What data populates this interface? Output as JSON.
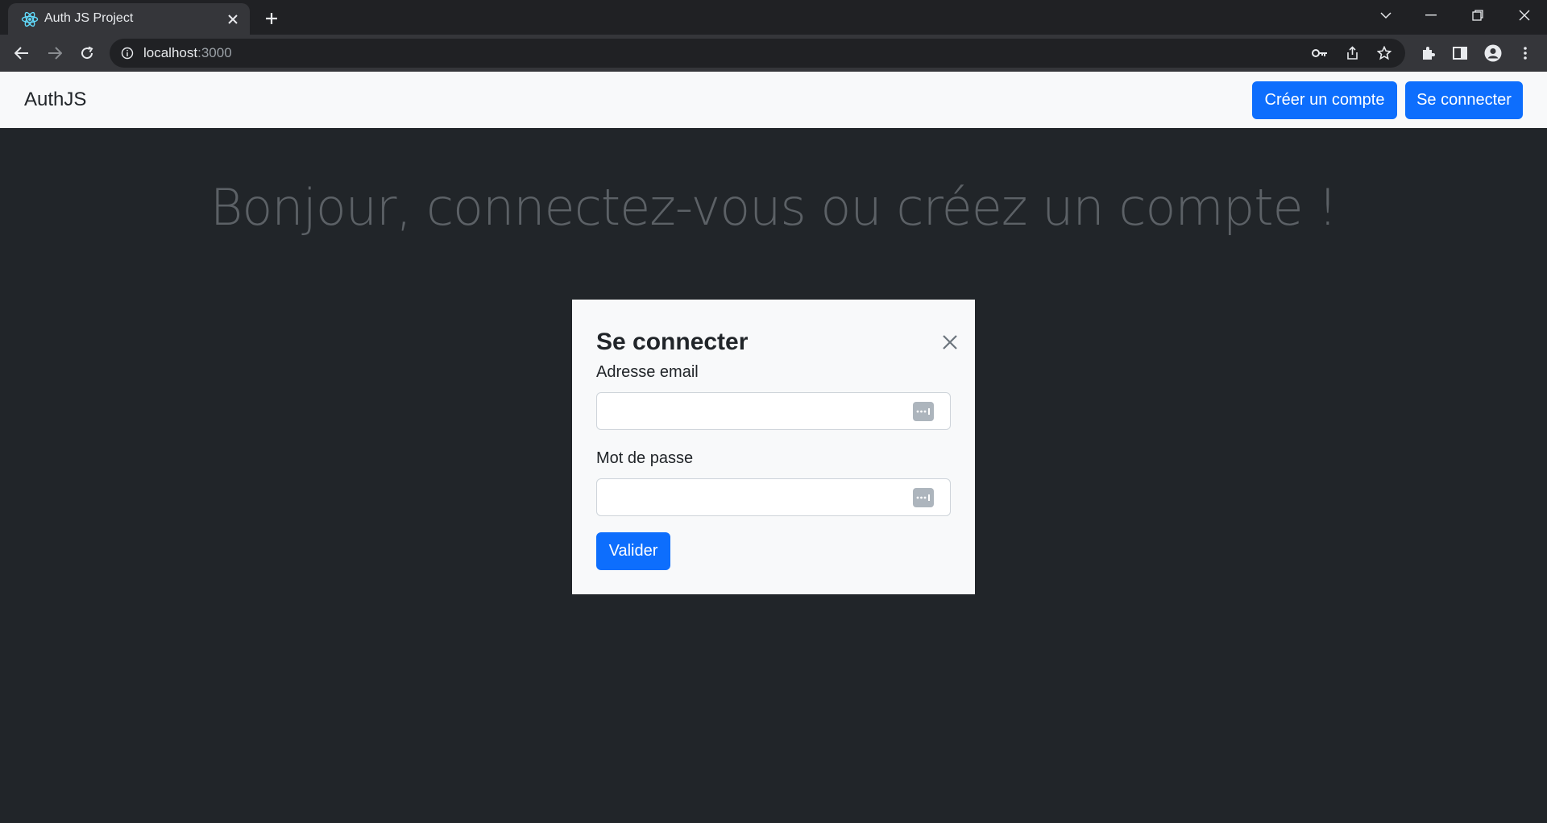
{
  "browser": {
    "tab_title": "Auth JS Project",
    "url_host": "localhost",
    "url_port": ":3000"
  },
  "navbar": {
    "brand": "AuthJS",
    "create_account_label": "Créer un compte",
    "login_label": "Se connecter"
  },
  "main": {
    "heading": "Bonjour, connectez-vous ou créez un compte !"
  },
  "modal": {
    "title": "Se connecter",
    "email_label": "Adresse email",
    "email_value": "",
    "password_label": "Mot de passe",
    "password_value": "",
    "submit_label": "Valider"
  },
  "colors": {
    "accent": "#0d6efd",
    "page_background": "#212529",
    "navbar_background": "#f8f9fa"
  }
}
